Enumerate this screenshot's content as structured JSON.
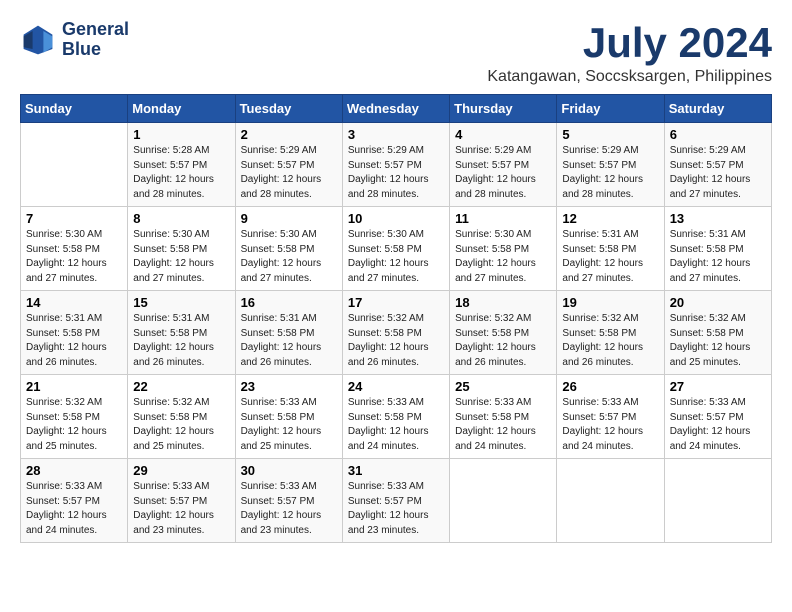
{
  "header": {
    "logo_line1": "General",
    "logo_line2": "Blue",
    "title": "July 2024",
    "subtitle": "Katangawan, Soccsksargen, Philippines"
  },
  "weekdays": [
    "Sunday",
    "Monday",
    "Tuesday",
    "Wednesday",
    "Thursday",
    "Friday",
    "Saturday"
  ],
  "weeks": [
    [
      {
        "day": "",
        "sunrise": "",
        "sunset": "",
        "daylight": ""
      },
      {
        "day": "1",
        "sunrise": "Sunrise: 5:28 AM",
        "sunset": "Sunset: 5:57 PM",
        "daylight": "Daylight: 12 hours and 28 minutes."
      },
      {
        "day": "2",
        "sunrise": "Sunrise: 5:29 AM",
        "sunset": "Sunset: 5:57 PM",
        "daylight": "Daylight: 12 hours and 28 minutes."
      },
      {
        "day": "3",
        "sunrise": "Sunrise: 5:29 AM",
        "sunset": "Sunset: 5:57 PM",
        "daylight": "Daylight: 12 hours and 28 minutes."
      },
      {
        "day": "4",
        "sunrise": "Sunrise: 5:29 AM",
        "sunset": "Sunset: 5:57 PM",
        "daylight": "Daylight: 12 hours and 28 minutes."
      },
      {
        "day": "5",
        "sunrise": "Sunrise: 5:29 AM",
        "sunset": "Sunset: 5:57 PM",
        "daylight": "Daylight: 12 hours and 28 minutes."
      },
      {
        "day": "6",
        "sunrise": "Sunrise: 5:29 AM",
        "sunset": "Sunset: 5:57 PM",
        "daylight": "Daylight: 12 hours and 27 minutes."
      }
    ],
    [
      {
        "day": "7",
        "sunrise": "Sunrise: 5:30 AM",
        "sunset": "Sunset: 5:58 PM",
        "daylight": "Daylight: 12 hours and 27 minutes."
      },
      {
        "day": "8",
        "sunrise": "Sunrise: 5:30 AM",
        "sunset": "Sunset: 5:58 PM",
        "daylight": "Daylight: 12 hours and 27 minutes."
      },
      {
        "day": "9",
        "sunrise": "Sunrise: 5:30 AM",
        "sunset": "Sunset: 5:58 PM",
        "daylight": "Daylight: 12 hours and 27 minutes."
      },
      {
        "day": "10",
        "sunrise": "Sunrise: 5:30 AM",
        "sunset": "Sunset: 5:58 PM",
        "daylight": "Daylight: 12 hours and 27 minutes."
      },
      {
        "day": "11",
        "sunrise": "Sunrise: 5:30 AM",
        "sunset": "Sunset: 5:58 PM",
        "daylight": "Daylight: 12 hours and 27 minutes."
      },
      {
        "day": "12",
        "sunrise": "Sunrise: 5:31 AM",
        "sunset": "Sunset: 5:58 PM",
        "daylight": "Daylight: 12 hours and 27 minutes."
      },
      {
        "day": "13",
        "sunrise": "Sunrise: 5:31 AM",
        "sunset": "Sunset: 5:58 PM",
        "daylight": "Daylight: 12 hours and 27 minutes."
      }
    ],
    [
      {
        "day": "14",
        "sunrise": "Sunrise: 5:31 AM",
        "sunset": "Sunset: 5:58 PM",
        "daylight": "Daylight: 12 hours and 26 minutes."
      },
      {
        "day": "15",
        "sunrise": "Sunrise: 5:31 AM",
        "sunset": "Sunset: 5:58 PM",
        "daylight": "Daylight: 12 hours and 26 minutes."
      },
      {
        "day": "16",
        "sunrise": "Sunrise: 5:31 AM",
        "sunset": "Sunset: 5:58 PM",
        "daylight": "Daylight: 12 hours and 26 minutes."
      },
      {
        "day": "17",
        "sunrise": "Sunrise: 5:32 AM",
        "sunset": "Sunset: 5:58 PM",
        "daylight": "Daylight: 12 hours and 26 minutes."
      },
      {
        "day": "18",
        "sunrise": "Sunrise: 5:32 AM",
        "sunset": "Sunset: 5:58 PM",
        "daylight": "Daylight: 12 hours and 26 minutes."
      },
      {
        "day": "19",
        "sunrise": "Sunrise: 5:32 AM",
        "sunset": "Sunset: 5:58 PM",
        "daylight": "Daylight: 12 hours and 26 minutes."
      },
      {
        "day": "20",
        "sunrise": "Sunrise: 5:32 AM",
        "sunset": "Sunset: 5:58 PM",
        "daylight": "Daylight: 12 hours and 25 minutes."
      }
    ],
    [
      {
        "day": "21",
        "sunrise": "Sunrise: 5:32 AM",
        "sunset": "Sunset: 5:58 PM",
        "daylight": "Daylight: 12 hours and 25 minutes."
      },
      {
        "day": "22",
        "sunrise": "Sunrise: 5:32 AM",
        "sunset": "Sunset: 5:58 PM",
        "daylight": "Daylight: 12 hours and 25 minutes."
      },
      {
        "day": "23",
        "sunrise": "Sunrise: 5:33 AM",
        "sunset": "Sunset: 5:58 PM",
        "daylight": "Daylight: 12 hours and 25 minutes."
      },
      {
        "day": "24",
        "sunrise": "Sunrise: 5:33 AM",
        "sunset": "Sunset: 5:58 PM",
        "daylight": "Daylight: 12 hours and 24 minutes."
      },
      {
        "day": "25",
        "sunrise": "Sunrise: 5:33 AM",
        "sunset": "Sunset: 5:58 PM",
        "daylight": "Daylight: 12 hours and 24 minutes."
      },
      {
        "day": "26",
        "sunrise": "Sunrise: 5:33 AM",
        "sunset": "Sunset: 5:57 PM",
        "daylight": "Daylight: 12 hours and 24 minutes."
      },
      {
        "day": "27",
        "sunrise": "Sunrise: 5:33 AM",
        "sunset": "Sunset: 5:57 PM",
        "daylight": "Daylight: 12 hours and 24 minutes."
      }
    ],
    [
      {
        "day": "28",
        "sunrise": "Sunrise: 5:33 AM",
        "sunset": "Sunset: 5:57 PM",
        "daylight": "Daylight: 12 hours and 24 minutes."
      },
      {
        "day": "29",
        "sunrise": "Sunrise: 5:33 AM",
        "sunset": "Sunset: 5:57 PM",
        "daylight": "Daylight: 12 hours and 23 minutes."
      },
      {
        "day": "30",
        "sunrise": "Sunrise: 5:33 AM",
        "sunset": "Sunset: 5:57 PM",
        "daylight": "Daylight: 12 hours and 23 minutes."
      },
      {
        "day": "31",
        "sunrise": "Sunrise: 5:33 AM",
        "sunset": "Sunset: 5:57 PM",
        "daylight": "Daylight: 12 hours and 23 minutes."
      },
      {
        "day": "",
        "sunrise": "",
        "sunset": "",
        "daylight": ""
      },
      {
        "day": "",
        "sunrise": "",
        "sunset": "",
        "daylight": ""
      },
      {
        "day": "",
        "sunrise": "",
        "sunset": "",
        "daylight": ""
      }
    ]
  ]
}
